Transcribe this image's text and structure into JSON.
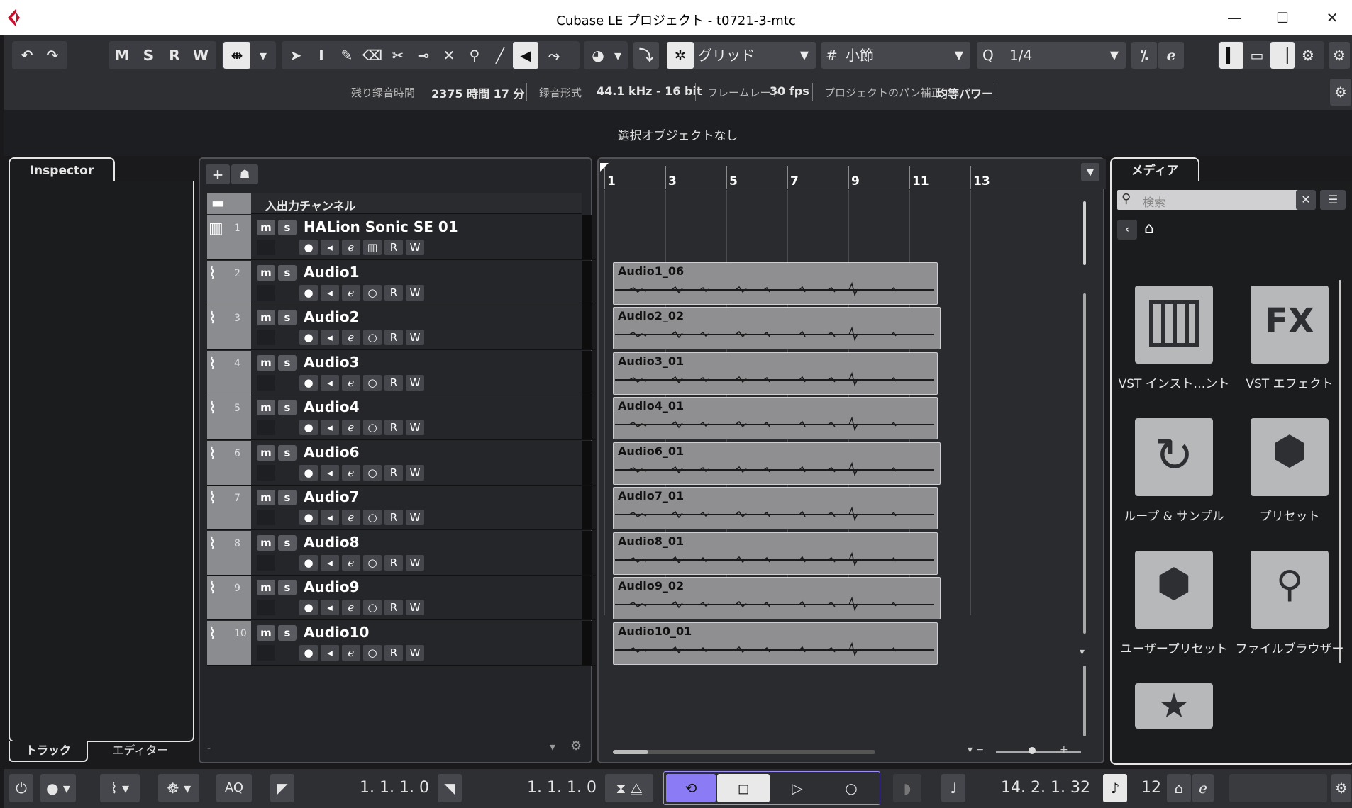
{
  "window": {
    "title": "Cubase LE プロジェクト - t0721-3-mtc",
    "minimize": "—",
    "maximize": "☐",
    "close": "✕"
  },
  "toolbar": {
    "m": "M",
    "s": "S",
    "r": "R",
    "w": "W",
    "grid_type": "グリッド",
    "grid_size": "小節",
    "quantize": "1/4",
    "quantize_icon": "Q"
  },
  "info": {
    "rec_time_label": "残り録音時間",
    "rec_time": "2375 時間 17 分",
    "rec_format_label": "録音形式",
    "rec_format": "44.1 kHz - 16 bit",
    "frame_rate_label": "フレームレート",
    "frame_rate": "30 fps",
    "pan_label": "プロジェクトのパン補正",
    "pan": "均等パワー"
  },
  "selection": "選択オブジェクトなし",
  "inspector": {
    "tab": "Inspector",
    "bottom_tabs": [
      "トラック",
      "エディター"
    ]
  },
  "tracklist": {
    "folder": "入出力チャンネル",
    "tracks": [
      {
        "num": "1",
        "name": "HALion Sonic SE 01",
        "type": "instrument"
      },
      {
        "num": "2",
        "name": "Audio1",
        "type": "audio"
      },
      {
        "num": "3",
        "name": "Audio2",
        "type": "audio"
      },
      {
        "num": "4",
        "name": "Audio3",
        "type": "audio"
      },
      {
        "num": "5",
        "name": "Audio4",
        "type": "audio"
      },
      {
        "num": "6",
        "name": "Audio6",
        "type": "audio"
      },
      {
        "num": "7",
        "name": "Audio7",
        "type": "audio"
      },
      {
        "num": "8",
        "name": "Audio8",
        "type": "audio"
      },
      {
        "num": "9",
        "name": "Audio9",
        "type": "audio"
      },
      {
        "num": "10",
        "name": "Audio10",
        "type": "audio"
      }
    ],
    "track_btn_m": "m",
    "track_btn_s": "s",
    "track_btn_r": "R",
    "track_btn_w": "W",
    "footer": "-"
  },
  "ruler": {
    "bars": [
      "1",
      "3",
      "5",
      "7",
      "9",
      "11",
      "13"
    ]
  },
  "clips": [
    "Audio1_06",
    "Audio2_02",
    "Audio3_01",
    "Audio4_01",
    "Audio6_01",
    "Audio7_01",
    "Audio8_01",
    "Audio9_02",
    "Audio10_01"
  ],
  "media": {
    "tab": "メディア",
    "search_placeholder": "検索",
    "items": [
      "VST インスト…ント",
      "VST エフェクト",
      "ループ & サンプル",
      "プリセット",
      "ユーザープリセット",
      "ファイルブラウザー"
    ],
    "tile_fx": "FX"
  },
  "transport": {
    "aq": "AQ",
    "left_locator": "1. 1. 1.   0",
    "right_locator": "1. 1. 1.   0",
    "position": "14. 2. 1. 32",
    "tempo": "12"
  },
  "colors": {
    "accent": "#8b7cf6",
    "clip": "#8f8f91",
    "bg": "#1a1a1c"
  }
}
